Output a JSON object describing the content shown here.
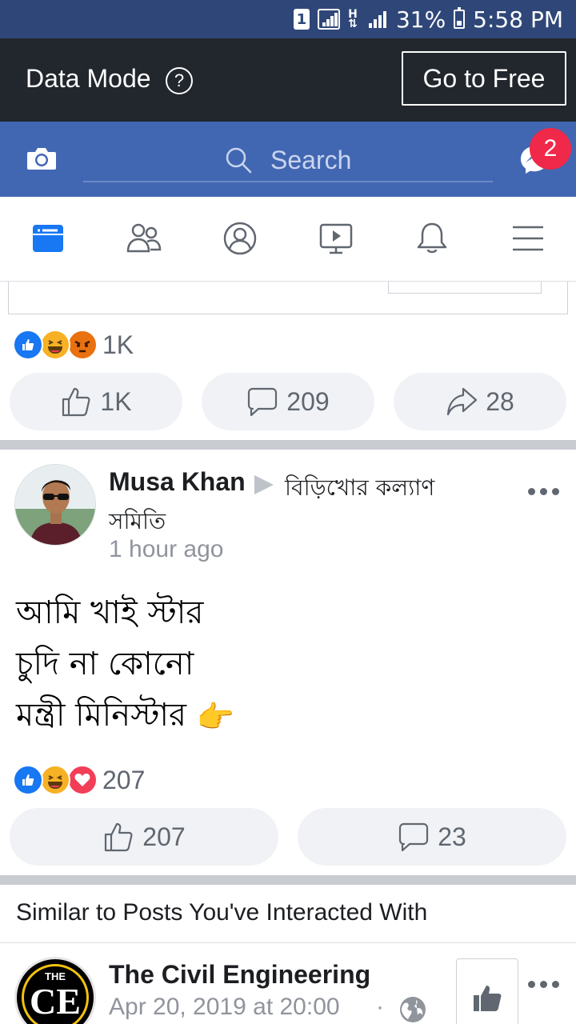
{
  "status_bar": {
    "sim": "1",
    "network": "H",
    "battery": "31%",
    "time": "5:58 PM"
  },
  "data_mode": {
    "label": "Data Mode",
    "help": "?",
    "button": "Go to Free"
  },
  "header": {
    "search_placeholder": "Search",
    "message_badge": "2"
  },
  "nav_tabs": [
    "news-feed",
    "friends",
    "profile",
    "watch",
    "notifications",
    "menu"
  ],
  "previous_post": {
    "reaction_count": "1K",
    "like_count": "1K",
    "comment_count": "209",
    "share_count": "28"
  },
  "post": {
    "author": "Musa Khan",
    "group_line1": "বিড়িখোর কল্যাণ",
    "group_line2": "সমিতি",
    "time": "1 hour ago",
    "lines": [
      "আমি খাই স্টার",
      "চুদি না কোনো",
      "মন্ত্রী মিনিস্টার"
    ],
    "emoji": "👉",
    "reaction_count": "207",
    "like_count": "207",
    "comment_count": "23"
  },
  "similar": {
    "heading": "Similar to Posts You've Interacted With",
    "logo_the": "THE",
    "logo_ce": "CE",
    "page_name": "The Civil Engineering",
    "page_date": "Apr 20, 2019 at 20:00",
    "separator": "·"
  },
  "colors": {
    "status_bar": "#2f4778",
    "data_mode_bar": "#22262d",
    "header_blue": "#4267b2",
    "badge_red": "#f02849",
    "like_blue": "#1877f2",
    "haha_yellow": "#f7b125",
    "angry_orange": "#e9710f",
    "love_red": "#f33e58"
  }
}
